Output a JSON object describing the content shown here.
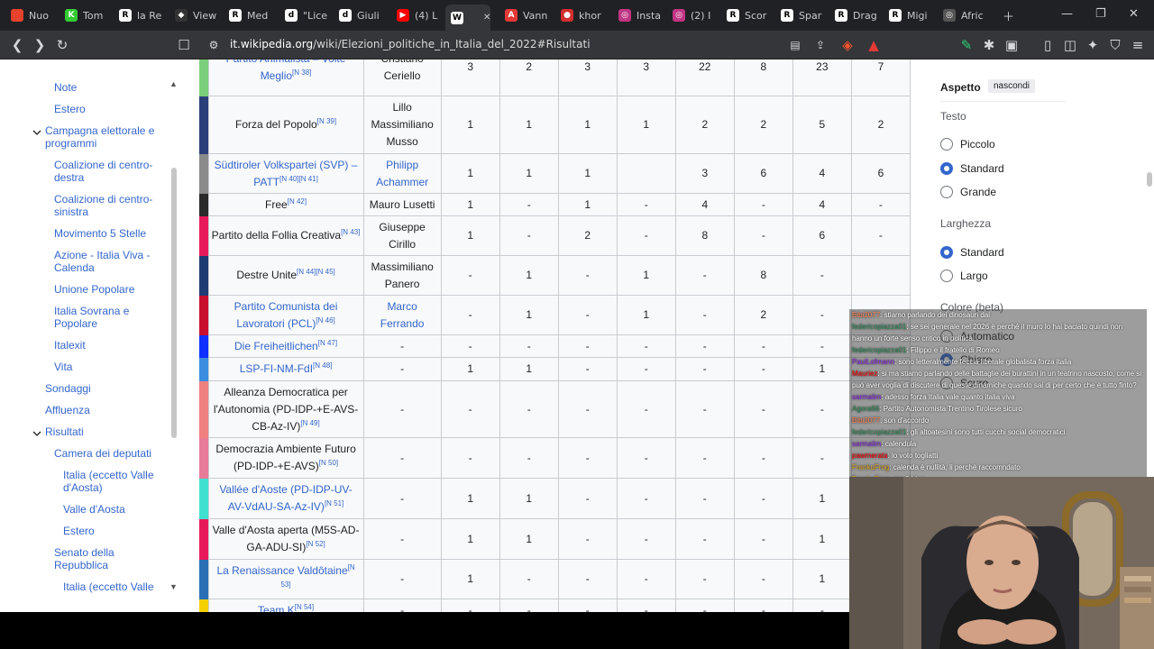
{
  "tabs": [
    {
      "label": "Nuo",
      "color": "#e8422d",
      "glyph": ""
    },
    {
      "label": "Tom",
      "color": "#33cc33",
      "glyph": "K"
    },
    {
      "label": "la Re",
      "color": "#ffffff",
      "glyph": "R"
    },
    {
      "label": "View",
      "color": "#333333",
      "glyph": "◆"
    },
    {
      "label": "Med",
      "color": "#ffffff",
      "glyph": "R"
    },
    {
      "label": "\"Lice",
      "color": "#ffffff",
      "glyph": "d"
    },
    {
      "label": "Giuli",
      "color": "#ffffff",
      "glyph": "d"
    },
    {
      "label": "(4) L",
      "color": "#ff0000",
      "glyph": "▶"
    },
    {
      "label": "",
      "color": "#ffffff",
      "glyph": "W"
    },
    {
      "label": "Vann",
      "color": "#e53935",
      "glyph": "A"
    },
    {
      "label": "khor",
      "color": "#d32f2f",
      "glyph": "●"
    },
    {
      "label": "Insta",
      "color": "#c13584",
      "glyph": "◎"
    },
    {
      "label": "(2) I",
      "color": "#c13584",
      "glyph": "◎"
    },
    {
      "label": "Scor",
      "color": "#ffffff",
      "glyph": "R"
    },
    {
      "label": "Spar",
      "color": "#ffffff",
      "glyph": "R"
    },
    {
      "label": "Drag",
      "color": "#ffffff",
      "glyph": "R"
    },
    {
      "label": "Migi",
      "color": "#ffffff",
      "glyph": "R"
    },
    {
      "label": "Afric",
      "color": "#555555",
      "glyph": "◎"
    }
  ],
  "address": {
    "domain": "it.wikipedia.org",
    "path": "/wiki/Elezioni_politiche_in_Italia_del_2022#Risultati"
  },
  "toc": {
    "items": [
      {
        "label": "Note",
        "level": 2
      },
      {
        "label": "Estero",
        "level": 2
      },
      {
        "label": "Campagna elettorale e programmi",
        "level": 1,
        "expand": true
      },
      {
        "label": "Coalizione di centro-destra",
        "level": 2
      },
      {
        "label": "Coalizione di centro-sinistra",
        "level": 2
      },
      {
        "label": "Movimento 5 Stelle",
        "level": 2
      },
      {
        "label": "Azione - Italia Viva - Calenda",
        "level": 2
      },
      {
        "label": "Unione Popolare",
        "level": 2
      },
      {
        "label": "Italia Sovrana e Popolare",
        "level": 2
      },
      {
        "label": "Italexit",
        "level": 2
      },
      {
        "label": "Vita",
        "level": 2
      },
      {
        "label": "Sondaggi",
        "level": 1
      },
      {
        "label": "Affluenza",
        "level": 1
      },
      {
        "label": "Risultati",
        "level": 1,
        "expand": true
      },
      {
        "label": "Camera dei deputati",
        "level": 2
      },
      {
        "label": "Italia (eccetto Valle d'Aosta)",
        "level": 3
      },
      {
        "label": "Valle d'Aosta",
        "level": 3
      },
      {
        "label": "Estero",
        "level": 3
      },
      {
        "label": "Senato della Repubblica",
        "level": 2
      },
      {
        "label": "Italia (eccetto Valle",
        "level": 3
      }
    ]
  },
  "table": {
    "rows": [
      {
        "color": "#7ad07a",
        "party": "Partito Animalista – Volte Meglio",
        "party_link": true,
        "ref": "[N 38]",
        "leader": "Cristiano Ceriello",
        "leader_link": false,
        "values": [
          "3",
          "2",
          "3",
          "3",
          "22",
          "8",
          "23",
          "7"
        ]
      },
      {
        "color": "#2a3f7a",
        "party": "Forza del Popolo",
        "party_link": false,
        "ref": "[N 39]",
        "leader": "Lillo Massimiliano Musso",
        "leader_link": false,
        "values": [
          "1",
          "1",
          "1",
          "1",
          "2",
          "2",
          "5",
          "2"
        ]
      },
      {
        "color": "#8a8a8a",
        "party": "Südtiroler Volkspartei (SVP) – PATT",
        "party_link": true,
        "ref": "[N 40][N 41]",
        "leader": "Philipp Achammer",
        "leader_link": true,
        "values": [
          "1",
          "1",
          "1",
          "",
          "3",
          "6",
          "4",
          "6"
        ]
      },
      {
        "color": "#2a2a2a",
        "party": "Free",
        "party_link": false,
        "ref": "[N 42]",
        "leader": "Mauro Lusetti",
        "leader_link": false,
        "values": [
          "1",
          "-",
          "1",
          "-",
          "4",
          "-",
          "4",
          "-"
        ]
      },
      {
        "color": "#e8195a",
        "party": "Partito della Follia Creativa",
        "party_link": false,
        "ref": "[N 43]",
        "leader": "Giuseppe Cirillo",
        "leader_link": false,
        "values": [
          "1",
          "-",
          "2",
          "-",
          "8",
          "-",
          "6",
          "-"
        ]
      },
      {
        "color": "#1f3b73",
        "party": "Destre Unite",
        "party_link": false,
        "ref": "[N 44][N 45]",
        "leader": "Massimiliano Panero",
        "leader_link": false,
        "values": [
          "-",
          "1",
          "-",
          "1",
          "-",
          "8",
          "-",
          ""
        ]
      },
      {
        "color": "#c8102e",
        "party": "Partito Comunista dei Lavoratori (PCL)",
        "party_link": true,
        "ref": "[N 46]",
        "leader": "Marco Ferrando",
        "leader_link": true,
        "values": [
          "-",
          "1",
          "-",
          "1",
          "-",
          "2",
          "-",
          ""
        ]
      },
      {
        "color": "#1030ff",
        "party": "Die Freiheitlichen",
        "party_link": true,
        "ref": "[N 47]",
        "leader": "-",
        "leader_link": false,
        "values": [
          "-",
          "-",
          "-",
          "-",
          "-",
          "-",
          "-",
          ""
        ]
      },
      {
        "color": "#3a8de0",
        "party": "LSP-FI-NM-FdI",
        "party_link": true,
        "ref": "[N 48]",
        "leader": "-",
        "leader_link": false,
        "values": [
          "1",
          "1",
          "-",
          "-",
          "-",
          "-",
          "1",
          ""
        ]
      },
      {
        "color": "#f08080",
        "party": "Alleanza Democratica per l'Autonomia (PD-IDP-+E-AVS-CB-Az-IV)",
        "party_link": false,
        "ref": "[N 49]",
        "leader": "-",
        "leader_link": false,
        "values": [
          "-",
          "-",
          "-",
          "-",
          "-",
          "-",
          "-",
          ""
        ]
      },
      {
        "color": "#e87a9a",
        "party": "Democrazia Ambiente Futuro (PD-IDP-+E-AVS)",
        "party_link": false,
        "ref": "[N 50]",
        "leader": "-",
        "leader_link": false,
        "values": [
          "-",
          "-",
          "-",
          "-",
          "-",
          "-",
          "-",
          ""
        ]
      },
      {
        "color": "#40e0d0",
        "party": "Vallée d'Aoste (PD-IDP-UV-AV-VdAU-SA-Az-IV)",
        "party_link": true,
        "ref": "[N 51]",
        "leader": "-",
        "leader_link": false,
        "values": [
          "1",
          "1",
          "-",
          "-",
          "-",
          "-",
          "1",
          ""
        ]
      },
      {
        "color": "#e8195a",
        "party": "Valle d'Aosta aperta (M5S-AD-GA-ADU-SI)",
        "party_link": false,
        "ref": "[N 52]",
        "leader": "-",
        "leader_link": false,
        "values": [
          "1",
          "1",
          "-",
          "-",
          "-",
          "-",
          "1",
          ""
        ]
      },
      {
        "color": "#2a6fb5",
        "party": "La Renaissance Valdôtaine",
        "party_link": true,
        "ref": "[N 53]",
        "leader": "-",
        "leader_link": false,
        "values": [
          "1",
          "-",
          "-",
          "-",
          "-",
          "-",
          "1",
          ""
        ]
      },
      {
        "color": "#f5d000",
        "party": "Team K",
        "party_link": true,
        "ref": "[N 54]",
        "leader": "-",
        "leader_link": false,
        "values": [
          "-",
          "-",
          "-",
          "-",
          "-",
          "-",
          "-",
          ""
        ]
      }
    ]
  },
  "panel": {
    "title": "Aspetto",
    "hide": "nascondi",
    "text_heading": "Testo",
    "text_options": [
      {
        "label": "Piccolo",
        "on": false
      },
      {
        "label": "Standard",
        "on": true
      },
      {
        "label": "Grande",
        "on": false
      }
    ],
    "width_heading": "Larghezza",
    "width_options": [
      {
        "label": "Standard",
        "on": true
      },
      {
        "label": "Largo",
        "on": false
      }
    ],
    "color_heading": "Colore (beta)",
    "color_options": [
      {
        "label": "Automatico",
        "on": false
      },
      {
        "label": "Chiaro",
        "on": true
      },
      {
        "label": "Scuro",
        "on": false
      }
    ]
  },
  "chat": [
    {
      "user": "Bibi2077",
      "color": "#ff7f50",
      "text": ": stiamo parlando dei dinosauri dai"
    },
    {
      "user": "federicopiazza01",
      "color": "#2e8b57",
      "text": ": se sei generale nel 2026 è perché il muro lo hai baciato quindi non hanno un forte senso critico in politica"
    },
    {
      "user": "federicopiazza01",
      "color": "#2e8b57",
      "text": ": Filippo e il fratello di Romeo"
    },
    {
      "user": "PaulLofmann",
      "color": "#8a2be2",
      "text": ": sono letteralmente feccia liberale globalista forza italia"
    },
    {
      "user": "Mauriez",
      "color": "#ff0000",
      "text": ": si ma stiamo parlando delle battaglie dei burattini in un teatrino nascosto, come si può aver voglia di discutere di queste dinamiche quando sai di per certo che è tutto finto?"
    },
    {
      "user": "sarmalim",
      "color": "#8a2be2",
      "text": ": adesso forza Italia vale quanto italia viva"
    },
    {
      "user": "Agora66",
      "color": "#2e8b57",
      "text": ": Partito Autonomista Trentino Tirolese sicuro"
    },
    {
      "user": "Bibi2077",
      "color": "#ff7f50",
      "text": ": son d'accordo"
    },
    {
      "user": "federicopiazza01",
      "color": "#2e8b57",
      "text": ": gli altoatesini sono tutti cucchi social democratici"
    },
    {
      "user": "sarmalim",
      "color": "#8a2be2",
      "text": ": calendula"
    },
    {
      "user": "pawmerata",
      "color": "#ff0000",
      "text": ": lo voto togliatti"
    },
    {
      "user": "FrankuFrog",
      "color": "#daa520",
      "text": ": calendа è nullità, li perchè raccomndato"
    },
    {
      "user": "FrankuFrog",
      "color": "#daa520",
      "text": ": ma 0 idee"
    }
  ]
}
